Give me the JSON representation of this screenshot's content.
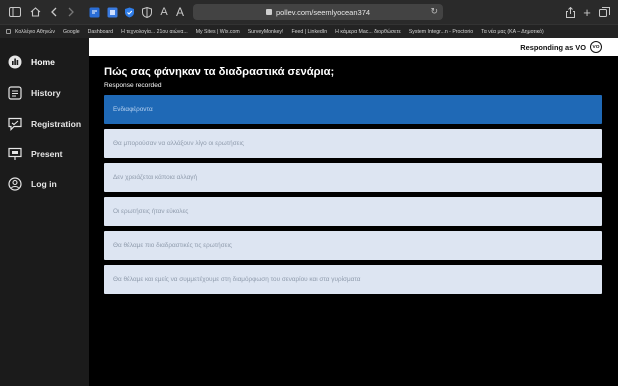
{
  "browser": {
    "url": "pollev.com/seemlyocean374",
    "reader_labels": [
      "A",
      "A"
    ]
  },
  "bookmarks": [
    "Κολλέγιο Αθηνών",
    "Google",
    "Dashboard",
    "Η τεχνολογία... 21ου αιώνα...",
    "My Sites | Wix.com",
    "SurveyMonkey!",
    "Feed | LinkedIn",
    "Η κάμερα Mac... διορθώσετε",
    "System Integr...n - Proctorio",
    "Τα νέα μας (ΚΑ – Δημοτικό)"
  ],
  "sidebar": {
    "items": [
      {
        "label": "Home",
        "icon": "dashboard-gauge-icon"
      },
      {
        "label": "History",
        "icon": "history-list-icon"
      },
      {
        "label": "Registration",
        "icon": "registration-chat-icon"
      },
      {
        "label": "Present",
        "icon": "presentation-screen-icon"
      },
      {
        "label": "Log in",
        "icon": "user-circle-icon"
      }
    ]
  },
  "header": {
    "responding_as": "Responding as VO",
    "avatar_initials": "VO"
  },
  "poll": {
    "question": "Πώς σας φάνηκαν τα διαδραστικά σενάρια;",
    "status": "Response recorded",
    "options": [
      {
        "label": "Ενδιαφέροντα",
        "selected": true
      },
      {
        "label": "Θα μπορούσαν να αλλάξουν λίγο οι ερωτήσεις",
        "selected": false
      },
      {
        "label": "Δεν χρειάζεται κάποια αλλαγή",
        "selected": false
      },
      {
        "label": "Οι ερωτήσεις ήταν εύκολες",
        "selected": false
      },
      {
        "label": "Θα θέλαμε πιο διαδραστικές τις ερωτήσεις",
        "selected": false
      },
      {
        "label": "Θα θέλαμε και εμείς να συμμετέχουμε στη διαμόρφωση του σεναρίου και στα γυρίσματα",
        "selected": false
      }
    ]
  },
  "colors": {
    "selected_option": "#1f69b6",
    "option_bg": "#dde5f2",
    "sidebar_bg": "#1b1b1b"
  }
}
